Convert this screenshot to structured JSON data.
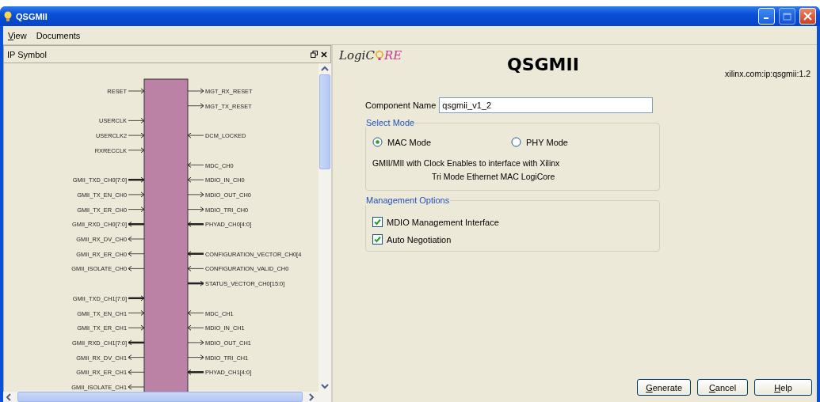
{
  "window": {
    "title": "QSGMII",
    "maximize_disabled": true
  },
  "menu": [
    "View",
    "Documents"
  ],
  "symbol_panel": {
    "title": "IP Symbol",
    "rows": [
      {
        "left": {
          "name": "RESET",
          "kind": "in",
          "bus": false
        },
        "right": {
          "name": "MGT_RX_RESET",
          "kind": "out",
          "bus": false
        }
      },
      {
        "right": {
          "name": "MGT_TX_RESET",
          "kind": "out",
          "bus": false
        }
      },
      {
        "left": {
          "name": "USERCLK",
          "kind": "in",
          "bus": false
        }
      },
      {
        "left": {
          "name": "USERCLK2",
          "kind": "in",
          "bus": false
        },
        "right": {
          "name": "DCM_LOCKED",
          "kind": "in",
          "bus": false
        }
      },
      {
        "left": {
          "name": "RXRECCLK",
          "kind": "in",
          "bus": false
        }
      },
      {
        "right": {
          "name": "MDC_CH0",
          "kind": "in",
          "bus": false
        }
      },
      {
        "left": {
          "name": "GMII_TXD_CH0[7:0]",
          "kind": "in",
          "bus": true
        },
        "right": {
          "name": "MDIO_IN_CH0",
          "kind": "in",
          "bus": false
        }
      },
      {
        "left": {
          "name": "GMII_TX_EN_CH0",
          "kind": "in",
          "bus": false
        },
        "right": {
          "name": "MDIO_OUT_CH0",
          "kind": "out",
          "bus": false
        }
      },
      {
        "left": {
          "name": "GMII_TX_ER_CH0",
          "kind": "in",
          "bus": false
        },
        "right": {
          "name": "MDIO_TRI_CH0",
          "kind": "out",
          "bus": false
        }
      },
      {
        "left": {
          "name": "GMII_RXD_CH0[7:0]",
          "kind": "out",
          "bus": true
        },
        "right": {
          "name": "PHYAD_CH0[4:0]",
          "kind": "in",
          "bus": true
        }
      },
      {
        "left": {
          "name": "GMII_RX_DV_CH0",
          "kind": "out",
          "bus": false
        }
      },
      {
        "left": {
          "name": "GMII_RX_ER_CH0",
          "kind": "out",
          "bus": false
        },
        "right": {
          "name": "CONFIGURATION_VECTOR_CH0[4",
          "kind": "in",
          "bus": true
        }
      },
      {
        "left": {
          "name": "GMII_ISOLATE_CH0",
          "kind": "out",
          "bus": false
        },
        "right": {
          "name": "CONFIGURATION_VALID_CH0",
          "kind": "in",
          "bus": false
        }
      },
      {
        "right": {
          "name": "STATUS_VECTOR_CH0[15:0]",
          "kind": "out",
          "bus": true
        }
      },
      {
        "left": {
          "name": "GMII_TXD_CH1[7:0]",
          "kind": "in",
          "bus": true
        }
      },
      {
        "left": {
          "name": "GMII_TX_EN_CH1",
          "kind": "in",
          "bus": false
        },
        "right": {
          "name": "MDC_CH1",
          "kind": "in",
          "bus": false
        }
      },
      {
        "left": {
          "name": "GMII_TX_ER_CH1",
          "kind": "in",
          "bus": false
        },
        "right": {
          "name": "MDIO_IN_CH1",
          "kind": "in",
          "bus": false
        }
      },
      {
        "left": {
          "name": "GMII_RXD_CH1[7:0]",
          "kind": "out",
          "bus": true
        },
        "right": {
          "name": "MDIO_OUT_CH1",
          "kind": "out",
          "bus": false
        }
      },
      {
        "left": {
          "name": "GMII_RX_DV_CH1",
          "kind": "out",
          "bus": false
        },
        "right": {
          "name": "MDIO_TRI_CH1",
          "kind": "out",
          "bus": false
        }
      },
      {
        "left": {
          "name": "GMII_RX_ER_CH1",
          "kind": "out",
          "bus": false
        },
        "right": {
          "name": "PHYAD_CH1[4:0]",
          "kind": "in",
          "bus": true
        }
      },
      {
        "left": {
          "name": "GMII_ISOLATE_CH1",
          "kind": "out",
          "bus": false
        }
      }
    ]
  },
  "header": {
    "logo_before": "LogiC",
    "logo_after": "RE",
    "title": "QSGMII",
    "ip_id": "xilinx.com:ip:qsgmii:1.2"
  },
  "component_name": {
    "label": "Component Name",
    "value": "qsgmii_v1_2"
  },
  "select_mode": {
    "legend": "Select Mode",
    "options": [
      {
        "label": "MAC Mode",
        "selected": true
      },
      {
        "label": "PHY Mode",
        "selected": false
      }
    ],
    "description": [
      "GMII/MII with Clock Enables to interface with Xilinx",
      "Tri Mode Ethernet MAC LogiCore"
    ]
  },
  "management": {
    "legend": "Management Options",
    "options": [
      {
        "label": "MDIO Management Interface",
        "checked": true
      },
      {
        "label": "Auto Negotiation",
        "checked": true
      }
    ]
  },
  "buttons": [
    "Generate",
    "Cancel",
    "Help"
  ]
}
